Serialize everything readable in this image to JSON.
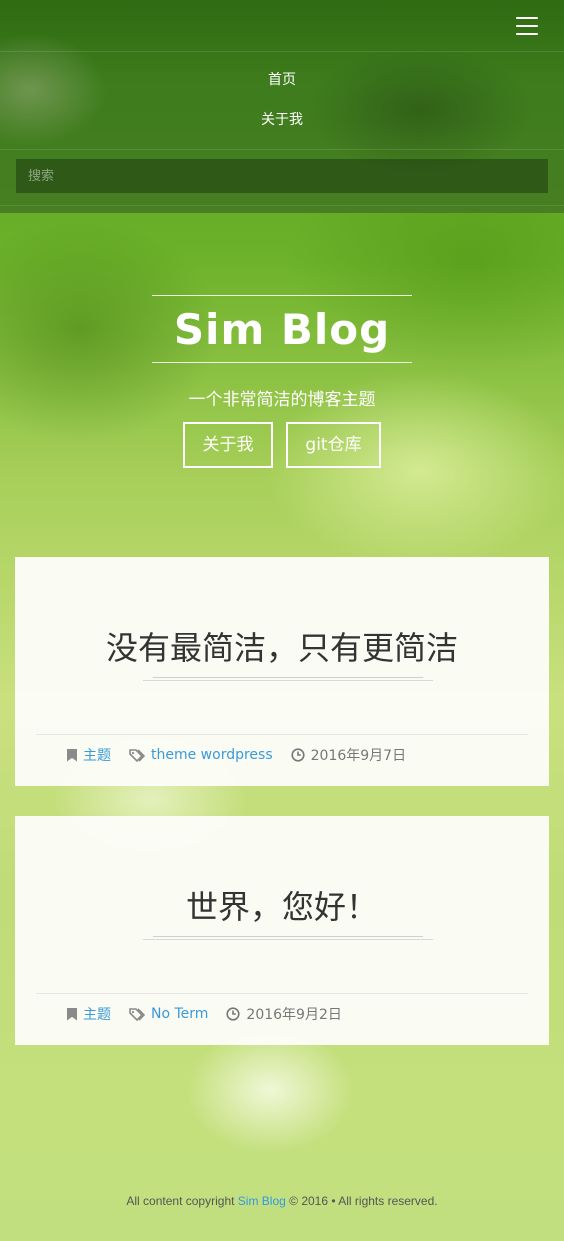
{
  "nav": {
    "menu_items": [
      "首页",
      "关于我"
    ],
    "search_placeholder": "搜索"
  },
  "hero": {
    "title": "Sim Blog",
    "tagline": "一个非常简洁的博客主题",
    "buttons": [
      "关于我",
      "git仓库"
    ]
  },
  "posts": [
    {
      "title": "没有最简洁，只有更简洁",
      "category": "主题",
      "tags": "theme wordpress",
      "date": "2016年9月7日"
    },
    {
      "title": "世界，您好！",
      "category": "主题",
      "tags": "No Term",
      "date": "2016年9月2日"
    }
  ],
  "footer": {
    "prefix": "All content copyright ",
    "site_link": "Sim Blog",
    "suffix": " © 2016 • All rights reserved."
  },
  "colors": {
    "link": "#3a9ad9",
    "nav_bg": "#3e7c1d",
    "text_dark": "#333333"
  }
}
